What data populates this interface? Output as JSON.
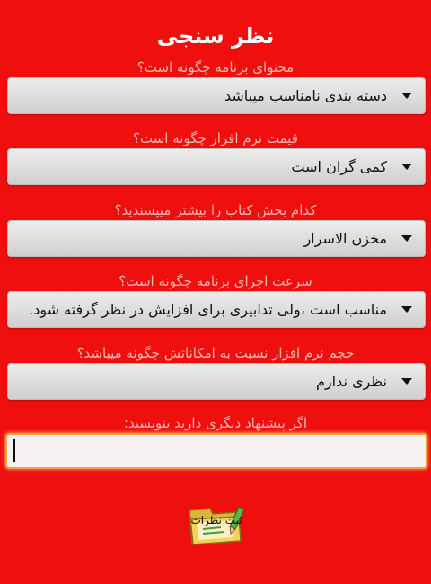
{
  "title": "نظر سنجی",
  "questions": [
    {
      "label": "محتوای برنامه چگونه است؟",
      "value": "دسته بندی نامناسب میباشد"
    },
    {
      "label": "قیمت نرم افزار چگونه است؟",
      "value": "کمی گران است"
    },
    {
      "label": "کدام بخش کتاب را بیشتر میپسندید؟",
      "value": "مخزن الاسرار"
    },
    {
      "label": "سرعت اجرای برنامه چگونه است؟",
      "value": "مناسب است ،ولی تدابیری برای افزایش در نظر گرفته شود."
    },
    {
      "label": "حجم نرم افزار نسبت به امکاناتش چگونه میباشد؟",
      "value": "نظری ندارم"
    }
  ],
  "suggestion": {
    "label": "اگر پیشنهاد دیگری دارید بنویسید:",
    "value": ""
  },
  "submit": {
    "label": "ثبت نظرات",
    "icon": "folder-pencil-icon"
  },
  "colors": {
    "background": "#ef0f0f",
    "question_label": "#f6b7b2",
    "input_focus": "#f2a23a"
  }
}
